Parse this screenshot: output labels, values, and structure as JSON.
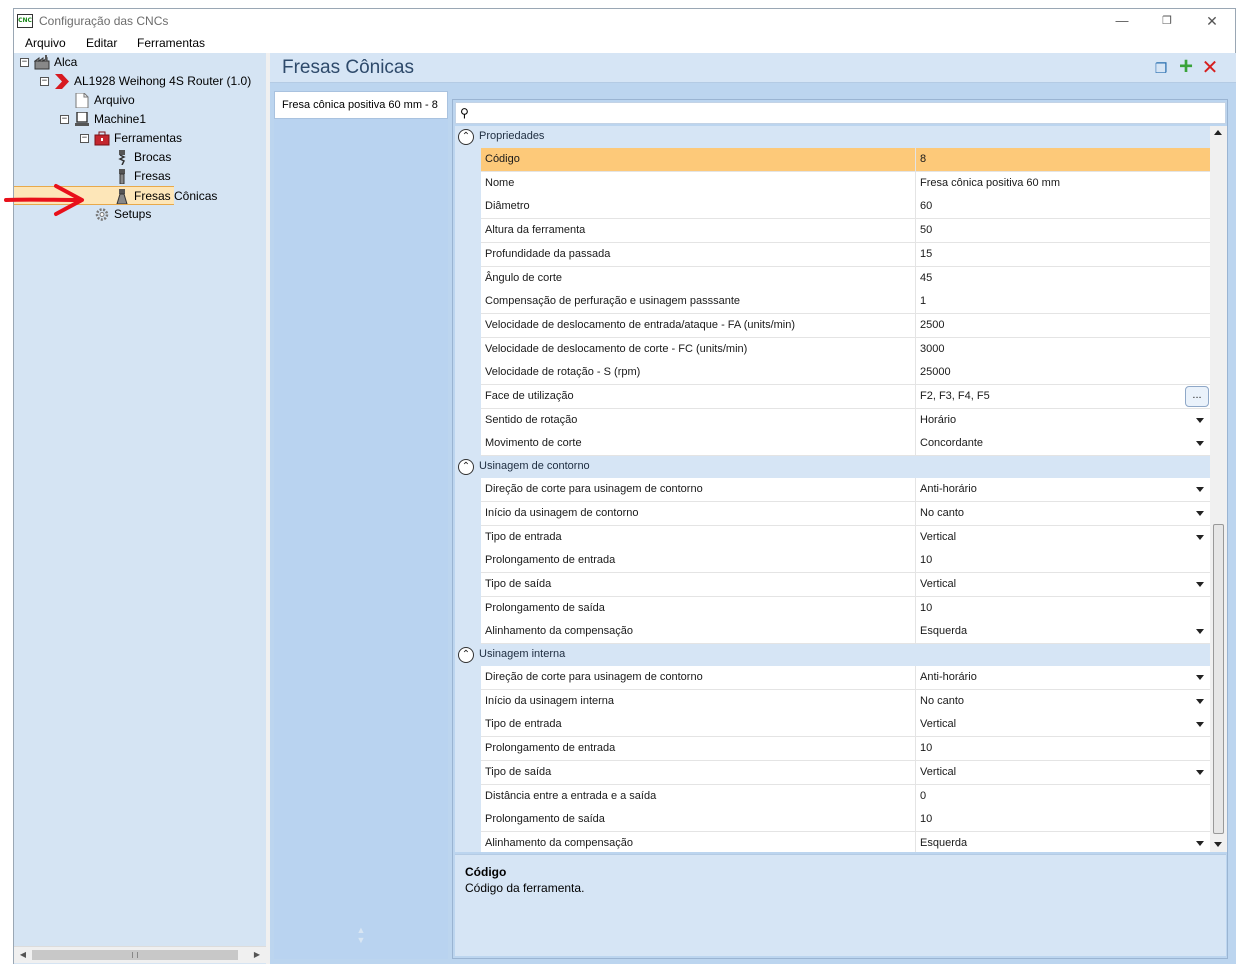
{
  "window": {
    "title": "Configuração das CNCs",
    "icon_text": "CNC"
  },
  "menu": [
    "Arquivo",
    "Editar",
    "Ferramentas"
  ],
  "tree": [
    {
      "label": "Alca",
      "icon": "factory-icon",
      "expander": "−"
    },
    {
      "label": "AL1928 Weihong 4S Router (1.0)",
      "icon": "router-chevron-icon",
      "expander": "−"
    },
    {
      "label": "Arquivo",
      "icon": "file-icon"
    },
    {
      "label": "Machine1",
      "icon": "machine-icon",
      "expander": "−"
    },
    {
      "label": "Ferramentas",
      "icon": "toolbox-icon",
      "expander": "−"
    },
    {
      "label": "Brocas",
      "icon": "drill-bit-icon"
    },
    {
      "label": "Fresas",
      "icon": "mill-bit-icon"
    },
    {
      "label": "Fresas Cônicas",
      "icon": "conical-mill-icon",
      "selected": true
    },
    {
      "label": "Setups",
      "icon": "gear-icon"
    }
  ],
  "content": {
    "title": "Fresas Cônicas",
    "actions": [
      "copy-icon",
      "add-icon",
      "delete-icon"
    ]
  },
  "tool_list": {
    "items": [
      "Fresa cônica positiva 60 mm - 8"
    ]
  },
  "property_grid": {
    "categories": [
      {
        "label": "Propriedades",
        "rows": [
          {
            "name": "Código",
            "value": "8",
            "selected": true
          },
          {
            "name": "Nome",
            "value": "Fresa cônica positiva 60 mm"
          },
          {
            "name": "Diâmetro",
            "value": "60"
          },
          {
            "name": "Altura da ferramenta",
            "value": "50"
          },
          {
            "name": "Profundidade da passada",
            "value": "15"
          },
          {
            "name": "Ângulo de corte",
            "value": "45"
          },
          {
            "name": "Compensação de perfuração e usinagem passsante",
            "value": "1"
          },
          {
            "name": "Velocidade de deslocamento de entrada/ataque - FA (units/min)",
            "value": "2500"
          },
          {
            "name": "Velocidade de deslocamento de corte - FC (units/min)",
            "value": "3000"
          },
          {
            "name": "Velocidade de rotação - S (rpm)",
            "value": "25000"
          },
          {
            "name": "Face de utilização",
            "value": "F2, F3, F4, F5",
            "editor": "ellipsis",
            "editor_label": "..."
          },
          {
            "name": "Sentido de rotação",
            "value": "Horário",
            "editor": "dropdown"
          },
          {
            "name": "Movimento de corte",
            "value": "Concordante",
            "editor": "dropdown"
          }
        ]
      },
      {
        "label": "Usinagem de contorno",
        "rows": [
          {
            "name": "Direção de corte para usinagem de contorno",
            "value": "Anti-horário",
            "editor": "dropdown"
          },
          {
            "name": "Início da usinagem de contorno",
            "value": "No canto",
            "editor": "dropdown"
          },
          {
            "name": "Tipo de entrada",
            "value": "Vertical",
            "editor": "dropdown"
          },
          {
            "name": "Prolongamento de entrada",
            "value": "10"
          },
          {
            "name": "Tipo de saída",
            "value": "Vertical",
            "editor": "dropdown"
          },
          {
            "name": "Prolongamento de saída",
            "value": "10"
          },
          {
            "name": "Alinhamento da compensação",
            "value": "Esquerda",
            "editor": "dropdown"
          }
        ]
      },
      {
        "label": "Usinagem interna",
        "rows": [
          {
            "name": "Direção de corte para usinagem de contorno",
            "value": "Anti-horário",
            "editor": "dropdown"
          },
          {
            "name": "Início da usinagem interna",
            "value": "No canto",
            "editor": "dropdown"
          },
          {
            "name": "Tipo de entrada",
            "value": "Vertical",
            "editor": "dropdown"
          },
          {
            "name": "Prolongamento de entrada",
            "value": "10"
          },
          {
            "name": "Tipo de saída",
            "value": "Vertical",
            "editor": "dropdown"
          },
          {
            "name": "Distância entre a entrada e a saída",
            "value": "0"
          },
          {
            "name": "Prolongamento de saída",
            "value": "10"
          },
          {
            "name": "Alinhamento da compensação",
            "value": "Esquerda",
            "editor": "dropdown"
          }
        ]
      }
    ]
  },
  "description": {
    "title": "Código",
    "text": "Código da ferramenta."
  },
  "colors": {
    "selection": "#fdc979",
    "panel": "#d6e5f5",
    "accent_arrow": "#e8101a"
  }
}
